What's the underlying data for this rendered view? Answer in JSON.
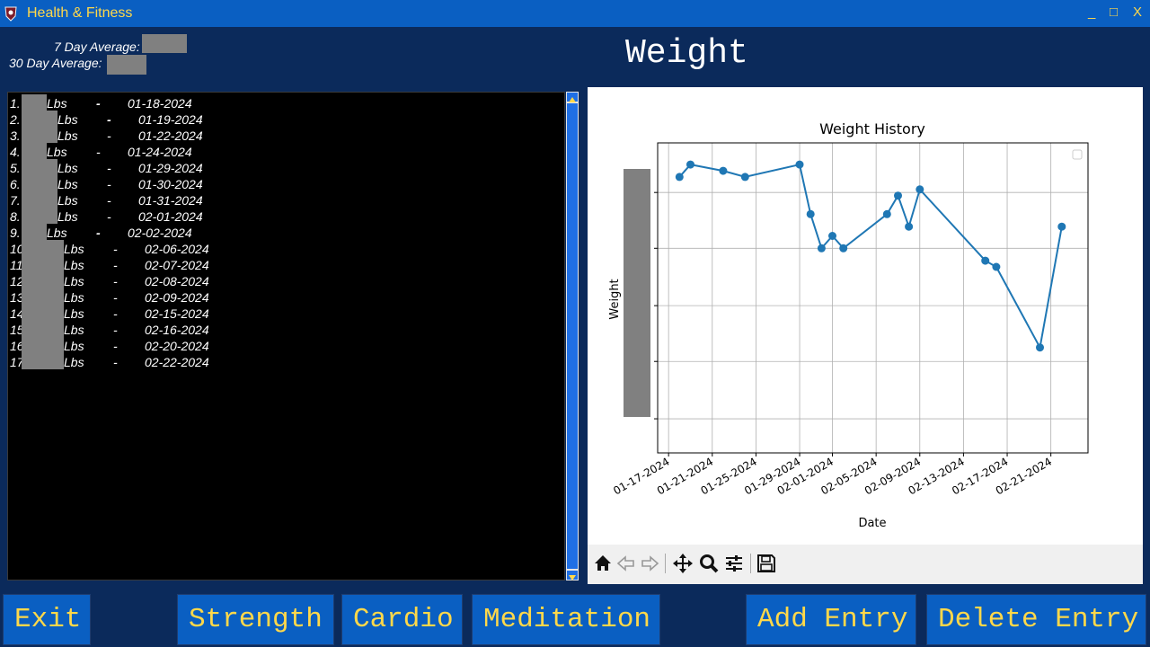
{
  "window": {
    "title": "Health & Fitness",
    "minimize": "_",
    "maximize": "□",
    "close": "X",
    "accent": "#0a5fc2",
    "title_color": "#ffd84a"
  },
  "averages": {
    "seven_day_label": "7 Day Average:",
    "thirty_day_label": "30 Day Average:"
  },
  "page_title": "Weight",
  "entries": [
    {
      "num": "1.",
      "unit": "Lbs",
      "dash": "-",
      "date": "01-18-2024"
    },
    {
      "num": "2.",
      "unit": "Lbs",
      "dash": "-",
      "date": "01-19-2024"
    },
    {
      "num": "3.",
      "unit": "Lbs",
      "dash": "-",
      "date": "01-22-2024"
    },
    {
      "num": "4.",
      "unit": "Lbs",
      "dash": "-",
      "date": "01-24-2024"
    },
    {
      "num": "5.",
      "unit": "Lbs",
      "dash": "-",
      "date": "01-29-2024"
    },
    {
      "num": "6.",
      "unit": "Lbs",
      "dash": "-",
      "date": "01-30-2024"
    },
    {
      "num": "7.",
      "unit": "Lbs",
      "dash": "-",
      "date": "01-31-2024"
    },
    {
      "num": "8.",
      "unit": "Lbs",
      "dash": "-",
      "date": "02-01-2024"
    },
    {
      "num": "9.",
      "unit": "Lbs",
      "dash": "-",
      "date": "02-02-2024"
    },
    {
      "num": "10",
      "unit": "Lbs",
      "dash": "-",
      "date": "02-06-2024"
    },
    {
      "num": "11",
      "unit": "Lbs",
      "dash": "-",
      "date": "02-07-2024"
    },
    {
      "num": "12",
      "unit": "Lbs",
      "dash": "-",
      "date": "02-08-2024"
    },
    {
      "num": "13",
      "unit": "Lbs",
      "dash": "-",
      "date": "02-09-2024"
    },
    {
      "num": "14",
      "unit": "Lbs",
      "dash": "-",
      "date": "02-15-2024"
    },
    {
      "num": "15",
      "unit": "Lbs",
      "dash": "-",
      "date": "02-16-2024"
    },
    {
      "num": "16",
      "unit": "Lbs",
      "dash": "-",
      "date": "02-20-2024"
    },
    {
      "num": "17",
      "unit": "Lbs",
      "dash": "-",
      "date": "02-22-2024"
    }
  ],
  "chart_data": {
    "type": "line",
    "title": "Weight History",
    "xlabel": "Date",
    "ylabel": "Weight",
    "x_tick_labels": [
      "01-17-2024",
      "01-21-2024",
      "01-25-2024",
      "01-29-2024",
      "02-01-2024",
      "02-05-2024",
      "02-09-2024",
      "02-13-2024",
      "02-17-2024",
      "02-21-2024"
    ],
    "x": [
      "01-18-2024",
      "01-19-2024",
      "01-22-2024",
      "01-24-2024",
      "01-29-2024",
      "01-30-2024",
      "01-31-2024",
      "02-01-2024",
      "02-02-2024",
      "02-06-2024",
      "02-07-2024",
      "02-08-2024",
      "02-09-2024",
      "02-15-2024",
      "02-16-2024",
      "02-20-2024",
      "02-22-2024"
    ],
    "relative_values": [
      0.89,
      0.93,
      0.91,
      0.89,
      0.93,
      0.77,
      0.66,
      0.7,
      0.66,
      0.77,
      0.83,
      0.73,
      0.85,
      0.62,
      0.6,
      0.34,
      0.73
    ],
    "y_values_redacted": true,
    "grid": true,
    "legend": "top-right",
    "line_color": "#1f77b4"
  },
  "toolbar": {
    "icons": [
      "home-icon",
      "back-icon",
      "forward-icon",
      "pan-icon",
      "zoom-icon",
      "configure-subplots-icon",
      "save-icon"
    ]
  },
  "buttons": {
    "exit": "Exit",
    "strength": "Strength",
    "cardio": "Cardio",
    "meditation": "Meditation",
    "add_entry": "Add Entry",
    "delete_entry": "Delete Entry"
  }
}
